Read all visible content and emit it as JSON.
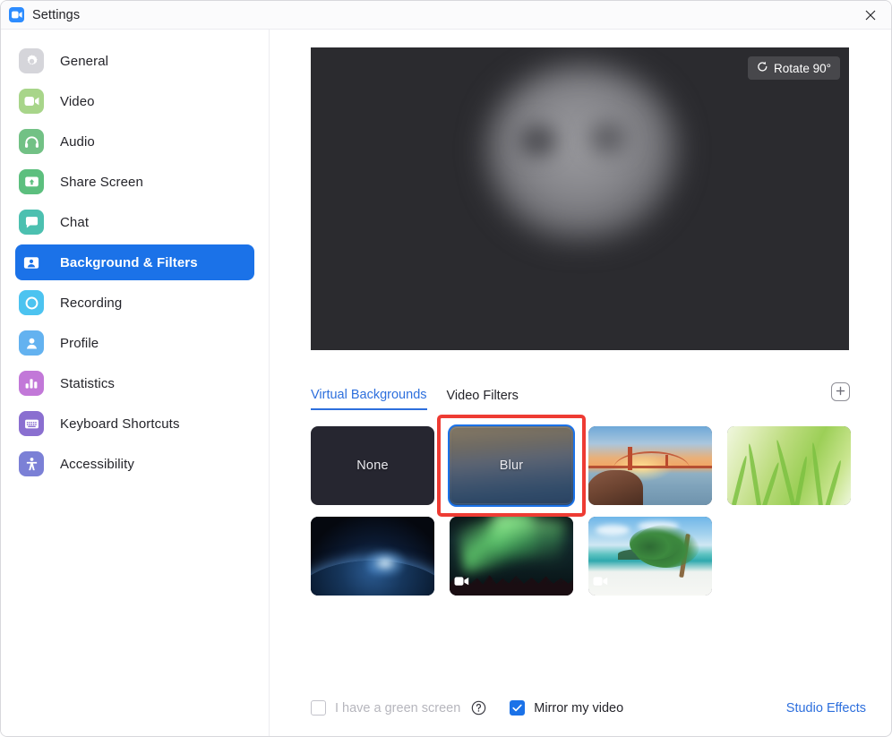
{
  "window": {
    "title": "Settings",
    "app_icon": "zoom-camera-icon",
    "close_icon": "close-icon"
  },
  "sidebar": {
    "items": [
      {
        "label": "General",
        "icon": "gear-icon",
        "color": "#d5d5da",
        "active": false
      },
      {
        "label": "Video",
        "icon": "video-camera-icon",
        "color": "#a8d58a",
        "active": false
      },
      {
        "label": "Audio",
        "icon": "headset-icon",
        "color": "#72c185",
        "active": false
      },
      {
        "label": "Share Screen",
        "icon": "share-screen-icon",
        "color": "#5cbf7e",
        "active": false
      },
      {
        "label": "Chat",
        "icon": "chat-bubble-icon",
        "color": "#4cc0b0",
        "active": false
      },
      {
        "label": "Background & Filters",
        "icon": "person-card-icon",
        "color": "#1b72e8",
        "active": true
      },
      {
        "label": "Recording",
        "icon": "record-circle-icon",
        "color": "#4cc3f0",
        "active": false
      },
      {
        "label": "Profile",
        "icon": "person-icon",
        "color": "#63b2f0",
        "active": false
      },
      {
        "label": "Statistics",
        "icon": "bar-chart-icon",
        "color": "#c278d8",
        "active": false
      },
      {
        "label": "Keyboard Shortcuts",
        "icon": "keyboard-icon",
        "color": "#8a6fd0",
        "active": false
      },
      {
        "label": "Accessibility",
        "icon": "accessibility-icon",
        "color": "#7b80d6",
        "active": false
      }
    ]
  },
  "preview": {
    "rotate_label": "Rotate 90°",
    "rotate_icon": "rotate-ccw-icon",
    "background_color": "#2b2b2f"
  },
  "tabs": {
    "items": [
      {
        "label": "Virtual Backgrounds",
        "active": true
      },
      {
        "label": "Video Filters",
        "active": false
      }
    ],
    "add_button_icon": "plus-icon",
    "active_color": "#2d6fdd"
  },
  "backgrounds": {
    "selected_index": 1,
    "selection_color": "#1b72e8",
    "annotation_color": "#ee3b33",
    "items": [
      {
        "label": "None",
        "art": "none",
        "video": false,
        "selected": false,
        "annotated": false
      },
      {
        "label": "Blur",
        "art": "blur",
        "video": false,
        "selected": true,
        "annotated": true
      },
      {
        "label": "",
        "art": "bridge",
        "video": false,
        "selected": false,
        "annotated": false
      },
      {
        "label": "",
        "art": "grass",
        "video": false,
        "selected": false,
        "annotated": false
      },
      {
        "label": "",
        "art": "earth",
        "video": false,
        "selected": false,
        "annotated": false
      },
      {
        "label": "",
        "art": "aurora",
        "video": true,
        "selected": false,
        "annotated": false
      },
      {
        "label": "",
        "art": "beach",
        "video": true,
        "selected": false,
        "annotated": false
      }
    ]
  },
  "bottom": {
    "green_screen_label": "I have a green screen",
    "green_screen_checked": false,
    "green_screen_disabled": true,
    "help_icon": "question-mark-icon",
    "mirror_label": "Mirror my video",
    "mirror_checked": true,
    "studio_effects_label": "Studio Effects",
    "link_color": "#2d6fdd"
  }
}
